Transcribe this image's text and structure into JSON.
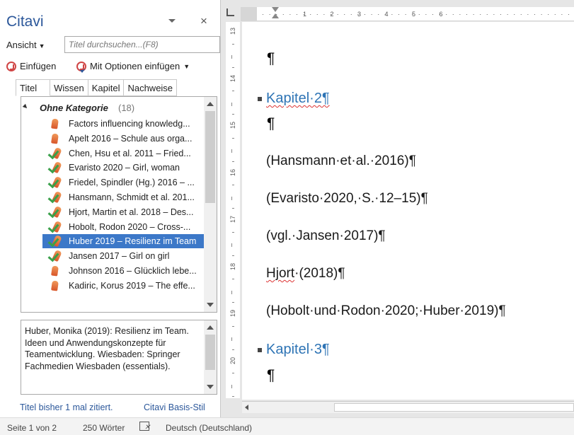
{
  "pane": {
    "title": "Citavi",
    "close": "×",
    "view_button": "Ansicht",
    "search_placeholder": "Titel durchsuchen...(F8)",
    "insert_label": "Einfügen",
    "insert_options_label": "Mit Optionen einfügen",
    "tabs": [
      "Titel",
      "Wissen",
      "Kapitel",
      "Nachweise"
    ],
    "group": {
      "label": "Ohne Kategorie",
      "count": "(18)"
    },
    "references": [
      {
        "text": "Factors influencing knowledg...",
        "icon": "book-icon",
        "selected": false
      },
      {
        "text": "Apelt 2016 – Schule aus orga...",
        "icon": "book-icon",
        "selected": false
      },
      {
        "text": "Chen, Hsu et al. 2011 – Fried...",
        "icon": "book-check-icon",
        "selected": false
      },
      {
        "text": "Evaristo 2020 – Girl, woman",
        "icon": "book-check-icon",
        "selected": false
      },
      {
        "text": "Friedel, Spindler (Hg.) 2016 – ...",
        "icon": "book-check-icon",
        "selected": false
      },
      {
        "text": "Hansmann, Schmidt et al. 201...",
        "icon": "book-check-icon",
        "selected": false
      },
      {
        "text": "Hjort, Martin et al. 2018 – Des...",
        "icon": "book-check-icon",
        "selected": false
      },
      {
        "text": "Hobolt, Rodon 2020 – Cross-...",
        "icon": "book-check-icon",
        "selected": false
      },
      {
        "text": "Huber 2019 – Resilienz im Team",
        "icon": "book-check-icon",
        "selected": true
      },
      {
        "text": "Jansen 2017 – Girl on girl",
        "icon": "book-check-icon",
        "selected": false
      },
      {
        "text": "Johnson 2016 – Glücklich lebe...",
        "icon": "book-icon",
        "selected": false
      },
      {
        "text": "Kadiric, Korus 2019 – The effe...",
        "icon": "book-icon",
        "selected": false
      }
    ],
    "detail_text": "Huber, Monika (2019): Resilienz im Team. Ideen und Anwendungskonzepte für Teamentwicklung. Wiesbaden: Springer Fachmedien Wiesbaden (essentials).",
    "footer_left": "Titel bisher 1 mal zitiert.",
    "footer_right": "Citavi Basis-Stil"
  },
  "ruler": {
    "horizontal": [
      "1",
      "2",
      "3",
      "4",
      "5",
      "6"
    ],
    "vertical": [
      "13",
      "14",
      "15",
      "16",
      "17",
      "18",
      "19",
      "20"
    ]
  },
  "document": {
    "pilcrow": "¶",
    "headings": [
      "Kapitel·2¶",
      "Kapitel·3¶"
    ],
    "citations": [
      "(Hansmann·et·al.·2016)¶",
      "(Evaristo·2020,·S.·12–15)¶",
      "(vgl.·Jansen·2017)¶",
      "(Hobolt·und·Rodon·2020;·Huber·2019)¶"
    ],
    "hjort_name": "Hjort",
    "hjort_rest": "·(2018)¶",
    "heading_color": "#2e74b5"
  },
  "status": {
    "page": "Seite 1 von 2",
    "words": "250 Wörter",
    "language": "Deutsch (Deutschland)"
  },
  "colors": {
    "accent": "#2b579a",
    "selection": "#3c78c8"
  }
}
